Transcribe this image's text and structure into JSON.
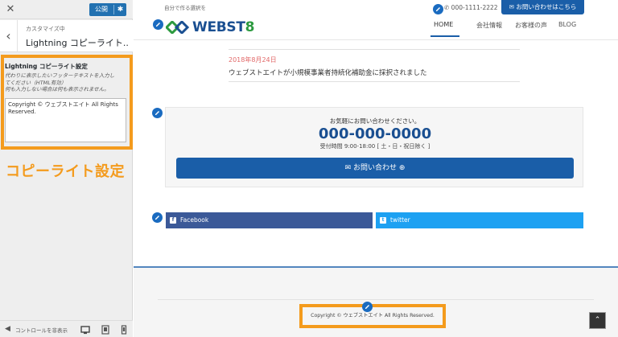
{
  "customizer": {
    "close_icon": "close-icon",
    "publish_label": "公開",
    "settings_icon": "gear-icon",
    "back_icon": "chevron-left-icon",
    "breadcrumb": "カスタマイズ中",
    "section_title": "Lightning コピーライト...",
    "setting": {
      "title": "Lightning コピーライト設定",
      "description_lines": [
        "代わりに表示したいフッターテキストを入力し",
        "てください（HTML有効）",
        "何も入力しない場合は何も表示されません。"
      ],
      "textarea_value": "Copyright © ウェブストエイト All Rights Reserved."
    },
    "callout_label": "コピーライト設定",
    "footer": {
      "hide_controls_label": "コントロールを非表示",
      "devices": [
        "desktop-icon",
        "tablet-icon",
        "mobile-icon"
      ]
    }
  },
  "site": {
    "tagline": "自分で作る選択を",
    "phone": "000-1111-2222",
    "contact_button_label": "お問い合わせはこちら",
    "logo_text": "WEBST8",
    "nav": [
      "HOME",
      "会社情報",
      "お客様の声",
      "BLOG"
    ],
    "news": {
      "date": "2018年8月24日",
      "title": "ウェブストエイトが小規模事業者持続化補助金に採択されました"
    },
    "cta": {
      "lead": "お気軽にお問い合わせください。",
      "phone": "000-000-0000",
      "hours": "受付時間 9:00-18:00 [ 土・日・祝日除く ]",
      "button_label": "お問い合わせ ⊕"
    },
    "share": {
      "facebook_label": "Facebook",
      "twitter_label": "twitter"
    },
    "copyright": "Copyright © ウェブストエイト All Rights Reserved.",
    "page_top_icon": "chevron-up-icon"
  },
  "colors": {
    "accent_blue": "#1a5ea8",
    "highlight_orange": "#f49b1d",
    "facebook": "#3b5998",
    "twitter": "#1da1f2",
    "news_date": "#e26a6a"
  }
}
